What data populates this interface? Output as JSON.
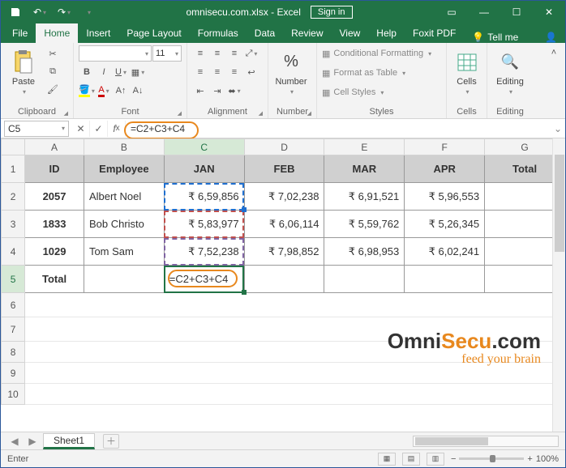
{
  "title": "omnisecu.com.xlsx - Excel",
  "signin": "Sign in",
  "tabs": {
    "file": "File",
    "home": "Home",
    "insert": "Insert",
    "pagelayout": "Page Layout",
    "formulas": "Formulas",
    "data": "Data",
    "review": "Review",
    "view": "View",
    "help": "Help",
    "foxit": "Foxit PDF",
    "tellme": "Tell me",
    "share": "Share"
  },
  "ribbon": {
    "clipboard": {
      "paste": "Paste",
      "label": "Clipboard"
    },
    "font": {
      "size": "11",
      "label": "Font"
    },
    "alignment": {
      "label": "Alignment"
    },
    "number": {
      "btn": "Number",
      "label": "Number"
    },
    "styles": {
      "cond": "Conditional Formatting",
      "table": "Format as Table",
      "cell": "Cell Styles",
      "label": "Styles"
    },
    "cells": {
      "btn": "Cells",
      "label": "Cells"
    },
    "editing": {
      "btn": "Editing",
      "label": "Editing"
    }
  },
  "namebox": "C5",
  "formula": "=C2+C3+C4",
  "cols": [
    "A",
    "B",
    "C",
    "D",
    "E",
    "F",
    "G"
  ],
  "headers": {
    "id": "ID",
    "emp": "Employee",
    "jan": "JAN",
    "feb": "FEB",
    "mar": "MAR",
    "apr": "APR",
    "total": "Total"
  },
  "rows": [
    {
      "id": "2057",
      "emp": "Albert Noel",
      "jan": "₹ 6,59,856",
      "feb": "₹ 7,02,238",
      "mar": "₹ 6,91,521",
      "apr": "₹ 5,96,553"
    },
    {
      "id": "1833",
      "emp": "Bob Christo",
      "jan": "₹ 5,83,977",
      "feb": "₹ 6,06,114",
      "mar": "₹ 5,59,762",
      "apr": "₹ 5,26,345"
    },
    {
      "id": "1029",
      "emp": "Tom Sam",
      "jan": "₹ 7,52,238",
      "feb": "₹ 7,98,852",
      "mar": "₹ 6,98,953",
      "apr": "₹ 6,02,241"
    }
  ],
  "totalrow": {
    "label": "Total",
    "formula": "=C2+C3+C4"
  },
  "watermark": {
    "a": "Omni",
    "b": "Secu",
    "c": ".com",
    "sub": "feed your brain"
  },
  "sheettab": "Sheet1",
  "status": {
    "mode": "Enter",
    "zoom": "100%"
  },
  "chart_data": {
    "type": "table",
    "columns": [
      "ID",
      "Employee",
      "JAN",
      "FEB",
      "MAR",
      "APR",
      "Total"
    ],
    "rows": [
      [
        "2057",
        "Albert Noel",
        659856,
        702238,
        691521,
        596553,
        null
      ],
      [
        "1833",
        "Bob Christo",
        583977,
        606114,
        559762,
        526345,
        null
      ],
      [
        "1029",
        "Tom Sam",
        752238,
        798852,
        698953,
        602241,
        null
      ],
      [
        "Total",
        null,
        "=C2+C3+C4",
        null,
        null,
        null,
        null
      ]
    ],
    "currency": "INR"
  }
}
